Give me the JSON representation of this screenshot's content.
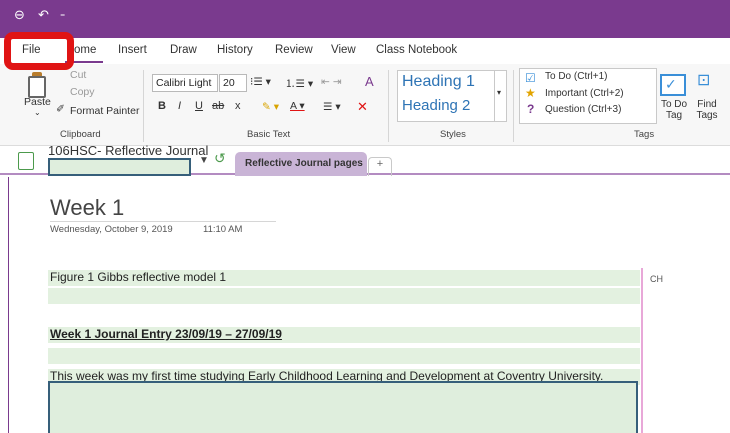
{
  "titlebar": {
    "back_icon": "back-circle-icon",
    "undo_icon": "undo-icon",
    "qat_icon": "customize-quick-access-icon"
  },
  "tabs": [
    {
      "label": "File"
    },
    {
      "label": "Home"
    },
    {
      "label": "Insert"
    },
    {
      "label": "Draw"
    },
    {
      "label": "History"
    },
    {
      "label": "Review"
    },
    {
      "label": "View"
    },
    {
      "label": "Class Notebook"
    }
  ],
  "visible_tabs": [
    "File",
    "ome",
    "Insert",
    "Draw",
    "History",
    "Review",
    "View",
    "Class Notebook"
  ],
  "highlight_color": "#e01414",
  "accent_color": "#7a3a8e",
  "clipboard": {
    "paste": "Paste",
    "cut": "Cut",
    "copy": "Copy",
    "format_painter": "Format Painter",
    "group": "Clipboard"
  },
  "basic_text": {
    "font": "Calibri Light",
    "size": "20",
    "bold": "B",
    "italic": "I",
    "underline": "U",
    "strike": "ab",
    "subscript": "x",
    "group": "Basic Text"
  },
  "styles": {
    "heading1": "Heading 1",
    "heading2": "Heading 2",
    "group": "Styles"
  },
  "tags": {
    "todo": "To Do (Ctrl+1)",
    "important": "Important (Ctrl+2)",
    "question": "Question (Ctrl+3)",
    "todo_tag": "To Do Tag",
    "find_tags": "Find Tags",
    "group": "Tags"
  },
  "notebook": {
    "name": "106HSC- Reflective Journal",
    "section": "Reflective Journal pages",
    "add_section": "+"
  },
  "page": {
    "title": "Week 1",
    "date": "Wednesday, October 9, 2019",
    "time": "11:10 AM",
    "initials": "CH",
    "lines": [
      "Figure 1   Gibbs reflective model  1",
      "Week 1 Journal Entry 23/09/19 – 27/09/19",
      "This week was my first time studying Early Childhood Learning and Development at Coventry University."
    ]
  }
}
